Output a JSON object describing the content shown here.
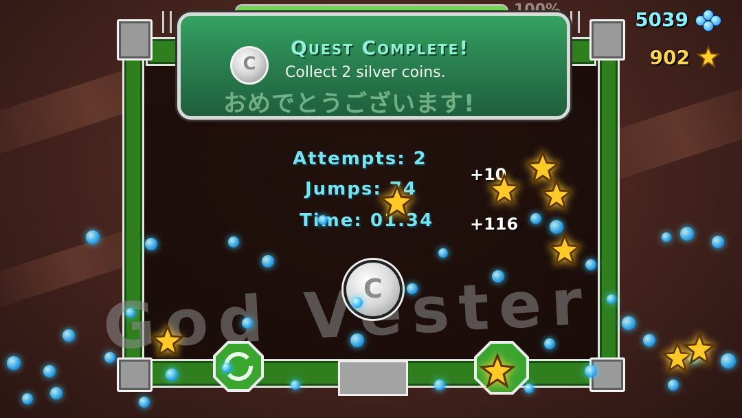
{
  "progress": {
    "percent": 100,
    "label": "100%"
  },
  "quest": {
    "title": "Quest Complete!",
    "description": "Collect 2 silver coins.",
    "subtitle_jp": "おめでとうございます!",
    "coin_glyph": "C"
  },
  "counters": {
    "orbs": "5039",
    "stars": "902"
  },
  "stats": {
    "attempts": "Attempts: 2",
    "jumps": "Jumps: 74",
    "time": "Time: 01.34"
  },
  "bonuses": {
    "first": "+10",
    "second": "+116"
  },
  "level_name": "God Vester",
  "center_coin_glyph": "C",
  "buttons": {
    "replay_icon": "replay-icon",
    "menu_icon": "star-icon"
  },
  "colors": {
    "accent_green": "#2f7f1f",
    "stat_cyan": "#76e3f0",
    "star_gold": "#ffd34a",
    "orb_blue": "#35b7ff"
  }
}
